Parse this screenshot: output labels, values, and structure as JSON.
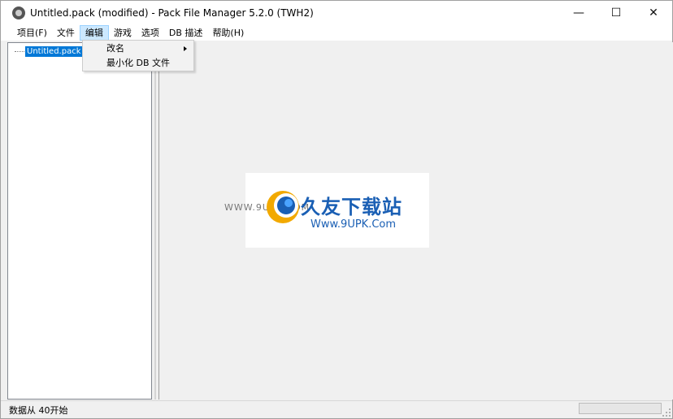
{
  "window": {
    "title": "Untitled.pack (modified) - Pack File Manager 5.2.0 (TWH2)",
    "controls": {
      "minimize": "—",
      "maximize": "☐",
      "close": "✕"
    }
  },
  "menubar": {
    "items": [
      "项目(F)",
      "文件",
      "编辑",
      "游戏",
      "选项",
      "DB 描述",
      "帮助(H)"
    ],
    "active_index": 2
  },
  "tree": {
    "root_label": "Untitled.pack"
  },
  "dropdown": {
    "items": [
      {
        "label": "改名",
        "has_submenu": true
      },
      {
        "label": "最小化 DB 文件",
        "has_submenu": false
      }
    ]
  },
  "watermark": {
    "url_left": "WWW.9UPK.COM",
    "title": "久友下载站",
    "subtitle": "Www.9UPK.Com"
  },
  "statusbar": {
    "text": "数据从 40开始",
    "progress": 0
  },
  "colors": {
    "accent": "#0078d7",
    "menu_active_bg": "#cce8ff",
    "watermark_blue": "#1a5fb4"
  }
}
